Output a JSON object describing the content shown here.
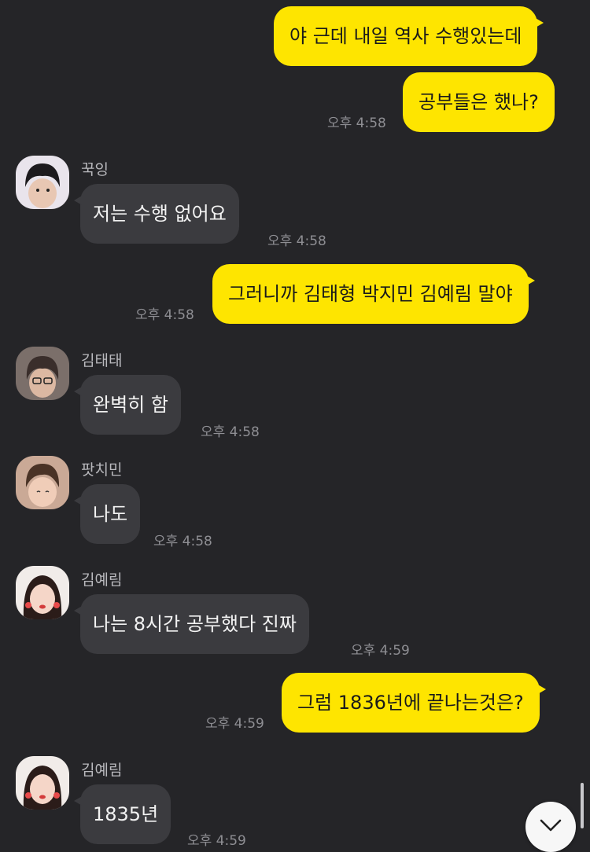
{
  "messages": {
    "m1": {
      "text": "야 근데 내일 역사 수행있는데"
    },
    "m2": {
      "text": "공부들은 했나?",
      "time": "오후 4:58"
    },
    "m3": {
      "sender": "꾹잉",
      "text": "저는 수행 없어요",
      "time": "오후 4:58"
    },
    "m4": {
      "text": "그러니까 김태형 박지민 김예림 말야",
      "time": "오후 4:58"
    },
    "m5": {
      "sender": "김태태",
      "text": "완벽히 함",
      "time": "오후 4:58"
    },
    "m6": {
      "sender": "팟치민",
      "text": "나도",
      "time": "오후 4:58"
    },
    "m7": {
      "sender": "김예림",
      "text": "나는 8시간 공부했다 진짜",
      "time": "오후 4:59"
    },
    "m8": {
      "text": "그럼 1836년에 끝나는것은?",
      "time": "오후 4:59"
    },
    "m9": {
      "sender": "김예림",
      "text": "1835년",
      "time": "오후 4:59"
    }
  },
  "colors": {
    "background": "#252528",
    "outgoing_bubble": "#fee500",
    "incoming_bubble": "#3b3b3f"
  },
  "icons": {
    "scroll_down": "chevron-down-icon"
  }
}
